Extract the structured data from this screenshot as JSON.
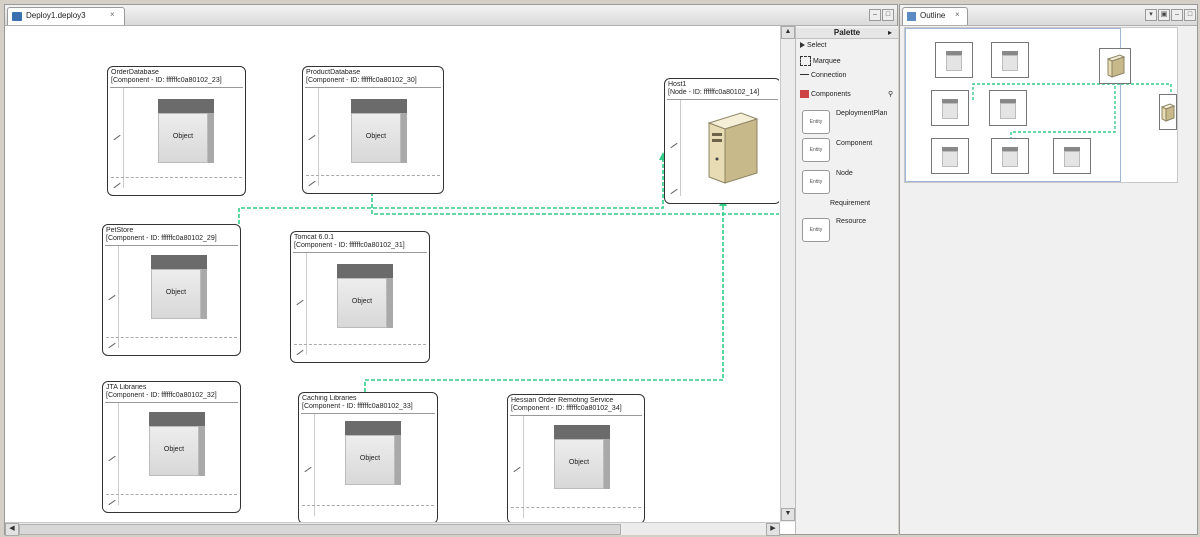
{
  "editor": {
    "tab_title": "Deploy1.deploy3",
    "close_glyph": "×"
  },
  "components": [
    {
      "id": "order-database",
      "title": "OrderDatabase",
      "subtitle": "[Component - ID: ffffffc0a80102_23]",
      "object_label": "Object"
    },
    {
      "id": "product-database",
      "title": "ProductDatabase",
      "subtitle": "[Component - ID: ffffffc0a80102_30]",
      "object_label": "Object"
    },
    {
      "id": "pet-store",
      "title": "PetStore",
      "subtitle": "[Component - ID: ffffffc0a80102_29]",
      "object_label": "Object"
    },
    {
      "id": "tomcat",
      "title": "Tomcat 6.0.1",
      "subtitle": "[Component - ID: ffffffc0a80102_31]",
      "object_label": "Object"
    },
    {
      "id": "jta-libraries",
      "title": "JTA Libraries",
      "subtitle": "[Component - ID: ffffffc0a80102_32]",
      "object_label": "Object"
    },
    {
      "id": "caching-libraries",
      "title": "Caching Libraries",
      "subtitle": "[Component - ID: ffffffc0a80102_33]",
      "object_label": "Object"
    },
    {
      "id": "hessian-service",
      "title": "Hessian Order Remoting Service",
      "subtitle": "[Component - ID: ffffffc0a80102_34]",
      "object_label": "Object"
    }
  ],
  "node": {
    "title": "Host1",
    "subtitle": "[Node - ID: ffffffc0a80102_14]"
  },
  "palette": {
    "title": "Palette",
    "select": "Select",
    "marquee": "Marquee",
    "connection": "Connection",
    "components_drawer": "Components",
    "entries": [
      {
        "label": "DeploymentPlan",
        "icon_text": "Entity"
      },
      {
        "label": "Component",
        "icon_text": "Entity"
      },
      {
        "label": "Node",
        "icon_text": "Entity"
      },
      {
        "label": "Requirement",
        "icon_text": ""
      },
      {
        "label": "Resource",
        "icon_text": "Entity"
      }
    ]
  },
  "outline": {
    "tab_title": "Outline",
    "close_glyph": "×"
  },
  "colors": {
    "connection": "#33cc88",
    "cube_top": "#6b6b6b",
    "tab_icon": "#3a6fb0"
  }
}
